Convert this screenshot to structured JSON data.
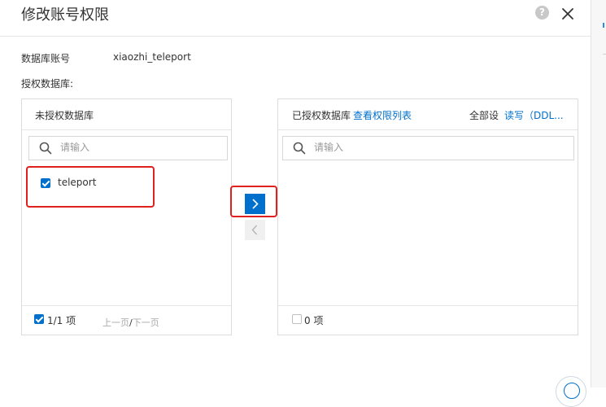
{
  "dialog": {
    "title": "修改账号权限",
    "help_icon": "question-circle-icon",
    "close_icon": "close-icon",
    "help_glyph": "?"
  },
  "account": {
    "label": "数据库账号",
    "value": "xiaozhi_teleport"
  },
  "authorize": {
    "label": "授权数据库:"
  },
  "left_panel": {
    "title": "未授权数据库",
    "search_placeholder": "请输入",
    "items": [
      {
        "label": "teleport",
        "checked": true
      }
    ],
    "footer": {
      "count": "1/1 项",
      "prev": "上一页",
      "separator": "/",
      "next": "下一页"
    }
  },
  "right_panel": {
    "title": "已授权数据库",
    "view_link": "查看权限列表",
    "set_all_label": "全部设",
    "read_write_link": "读写（DDL...",
    "search_placeholder": "请输入",
    "footer": {
      "count": "0 项"
    }
  },
  "transfer": {
    "to_right_icon": "chevron-right-icon",
    "to_left_icon": "chevron-left-icon"
  },
  "colors": {
    "primary": "#0070cc",
    "highlight": "#e0201c",
    "border": "#dcdcdc"
  }
}
